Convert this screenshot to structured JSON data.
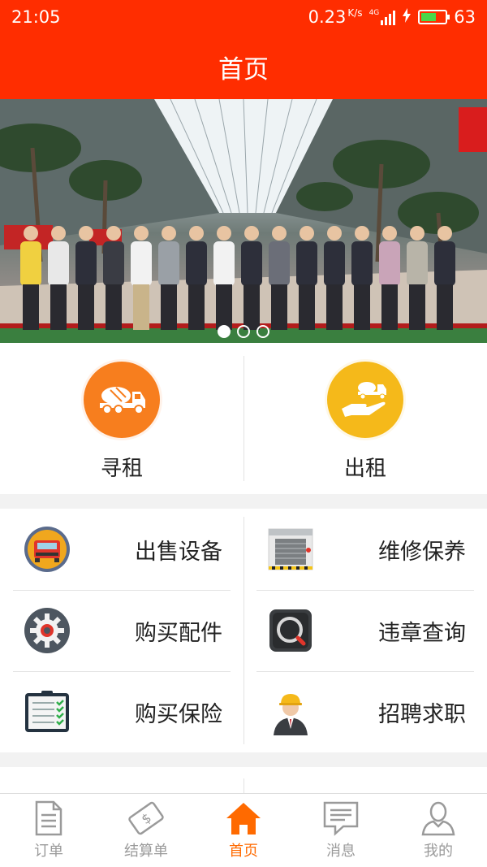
{
  "status": {
    "time": "21:05",
    "net_speed": "0.23",
    "net_unit": "K/s",
    "network": "4G",
    "battery": "63",
    "battery_level": 0.63
  },
  "header": {
    "title": "首页"
  },
  "banner": {
    "slide_count": 3,
    "active_slide": 0
  },
  "rent": [
    {
      "label": "寻租",
      "icon": "mixer-truck-icon",
      "color": "#f77e1e"
    },
    {
      "label": "出租",
      "icon": "hand-truck-icon",
      "color": "#f5b91a"
    }
  ],
  "services": [
    {
      "label": "出售设备",
      "icon": "truck-front-icon"
    },
    {
      "label": "维修保养",
      "icon": "garage-icon"
    },
    {
      "label": "购买配件",
      "icon": "gear-icon"
    },
    {
      "label": "违章查询",
      "icon": "magnifier-icon"
    },
    {
      "label": "购买保险",
      "icon": "checklist-icon"
    },
    {
      "label": "招聘求职",
      "icon": "worker-icon"
    }
  ],
  "tabs": [
    {
      "label": "订单",
      "icon": "document-icon",
      "active": false
    },
    {
      "label": "结算单",
      "icon": "bill-icon",
      "active": false
    },
    {
      "label": "首页",
      "icon": "home-icon",
      "active": true
    },
    {
      "label": "消息",
      "icon": "message-icon",
      "active": false
    },
    {
      "label": "我的",
      "icon": "user-icon",
      "active": false
    }
  ],
  "colors": {
    "primary": "#ff2d00",
    "tab_active": "#ff6a00",
    "tab_inactive": "#9a9a9a"
  }
}
